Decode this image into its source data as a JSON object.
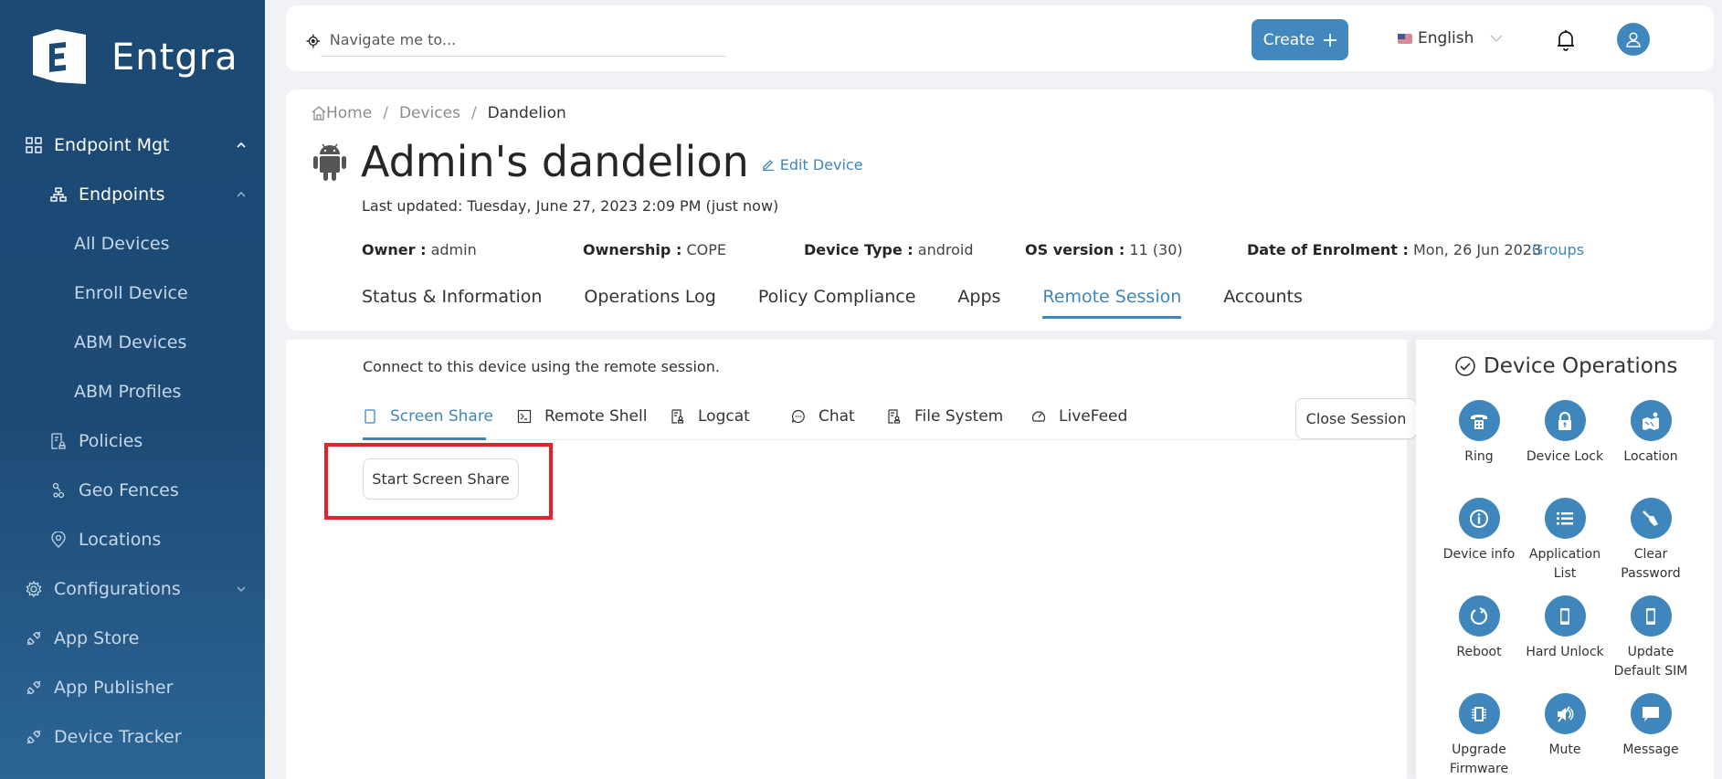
{
  "brand": {
    "name": "Entgra"
  },
  "sidebar": {
    "items": [
      {
        "label": "Endpoint Mgt",
        "icon": "grid-icon",
        "expanded": true
      },
      {
        "label": "Endpoints",
        "icon": "hierarchy-icon",
        "expanded": true
      },
      {
        "label": "All Devices"
      },
      {
        "label": "Enroll Device"
      },
      {
        "label": "ABM Devices"
      },
      {
        "label": "ABM Profiles"
      },
      {
        "label": "Policies",
        "icon": "policy-icon"
      },
      {
        "label": "Geo Fences",
        "icon": "geofence-icon"
      },
      {
        "label": "Locations",
        "icon": "location-pin-icon"
      },
      {
        "label": "Configurations",
        "icon": "gear-icon",
        "expanded": false
      },
      {
        "label": "App Store",
        "icon": "plug-icon"
      },
      {
        "label": "App Publisher",
        "icon": "plug-icon"
      },
      {
        "label": "Device Tracker",
        "icon": "plug-icon"
      }
    ]
  },
  "topbar": {
    "search_placeholder": "Navigate me to...",
    "create_label": "Create",
    "language": "English"
  },
  "breadcrumb": {
    "home": "Home",
    "devices": "Devices",
    "current": "Dandelion"
  },
  "device": {
    "title": "Admin's dandelion",
    "edit_label": "Edit Device",
    "last_updated": "Last updated: Tuesday, June 27, 2023 2:09 PM (just now)",
    "owner_label": "Owner :",
    "owner": "admin",
    "ownership_label": "Ownership :",
    "ownership": "COPE",
    "type_label": "Device Type :",
    "type": "android",
    "os_label": "OS version :",
    "os": "11 (30)",
    "enrol_label": "Date of Enrolment :",
    "enrol": "Mon, 26 Jun 2023",
    "groups_label": "Groups"
  },
  "tabs": [
    {
      "label": "Status & Information"
    },
    {
      "label": "Operations Log"
    },
    {
      "label": "Policy Compliance"
    },
    {
      "label": "Apps"
    },
    {
      "label": "Remote Session",
      "active": true
    },
    {
      "label": "Accounts"
    }
  ],
  "remote": {
    "intro": "Connect to this device using the remote session.",
    "subtabs": [
      {
        "label": "Screen Share",
        "icon": "mobile-icon",
        "active": true
      },
      {
        "label": "Remote Shell",
        "icon": "terminal-icon"
      },
      {
        "label": "Logcat",
        "icon": "log-icon"
      },
      {
        "label": "Chat",
        "icon": "chat-icon"
      },
      {
        "label": "File System",
        "icon": "file-system-icon"
      },
      {
        "label": "LiveFeed",
        "icon": "dashboard-icon"
      }
    ],
    "close_session_label": "Close Session",
    "start_label": "Start Screen Share"
  },
  "operations": {
    "title": "Device Operations",
    "items": [
      {
        "label": "Ring",
        "icon": "phone-icon"
      },
      {
        "label": "Device Lock",
        "icon": "lock-icon"
      },
      {
        "label": "Location",
        "icon": "map-icon"
      },
      {
        "label": "Device info",
        "icon": "info-icon"
      },
      {
        "label": "Application List",
        "icon": "list-icon"
      },
      {
        "label": "Clear Password",
        "icon": "broom-icon"
      },
      {
        "label": "Reboot",
        "icon": "reboot-icon"
      },
      {
        "label": "Hard Unlock",
        "icon": "mobile-icon"
      },
      {
        "label": "Update Default SIM",
        "icon": "mobile-icon"
      },
      {
        "label": "Upgrade Firmware",
        "icon": "chip-icon"
      },
      {
        "label": "Mute",
        "icon": "mute-icon"
      },
      {
        "label": "Message",
        "icon": "message-icon"
      }
    ]
  },
  "colors": {
    "accent": "#3f86bd",
    "sidebar": "#1c4a75",
    "highlight": "#e4222c"
  }
}
